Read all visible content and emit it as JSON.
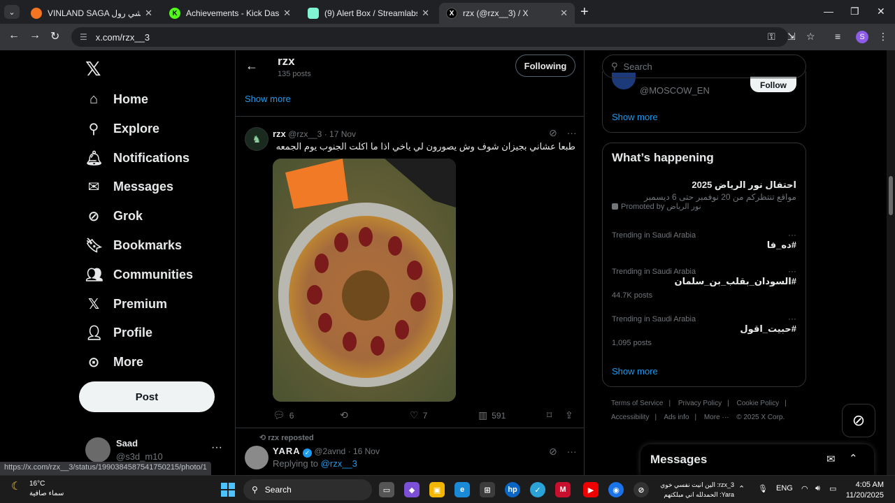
{
  "browser": {
    "tabs": [
      {
        "title": "VINLAND SAGA للي كرانشي رول",
        "color": "#f47521",
        "glyph": ""
      },
      {
        "title": "Achievements - Kick Dashboard",
        "color": "#53fc18",
        "glyph": "K"
      },
      {
        "title": "(9) Alert Box / Streamlabs",
        "color": "#80f5d2",
        "glyph": ""
      },
      {
        "title": "rzx (@rzx__3) / X",
        "color": "#000000",
        "glyph": "X"
      }
    ],
    "url": "x.com/rzx__3",
    "profile_initial": "S",
    "status_url": "https://x.com/rzx__3/status/1990384587541750215/photo/1"
  },
  "nav": {
    "items": [
      {
        "label": "Home",
        "icon": "home-icon"
      },
      {
        "label": "Explore",
        "icon": "search-icon"
      },
      {
        "label": "Notifications",
        "icon": "bell-icon"
      },
      {
        "label": "Messages",
        "icon": "mail-icon"
      },
      {
        "label": "Grok",
        "icon": "grok-icon"
      },
      {
        "label": "Bookmarks",
        "icon": "bookmark-icon"
      },
      {
        "label": "Communities",
        "icon": "people-icon"
      },
      {
        "label": "Premium",
        "icon": "x-icon"
      },
      {
        "label": "Profile",
        "icon": "person-icon"
      },
      {
        "label": "More",
        "icon": "more-circle-icon"
      }
    ],
    "post_label": "Post",
    "account": {
      "name": "Saad",
      "handle": "@s3d_m10"
    }
  },
  "profile_header": {
    "name": "rzx",
    "posts": "135 posts",
    "following_label": "Following",
    "show_more": "Show more"
  },
  "tweet": {
    "name": "rzx",
    "handle": "@rzx__3",
    "date": "17 Nov",
    "text": "طبعا عشاني بجيزان شوف وش يصورون لي ياخي اذا ما اكلت الجنوب يوم الجمعه",
    "replies": "6",
    "likes": "7",
    "views": "591"
  },
  "tweet2": {
    "repost_label": "rzx reposted",
    "name": "YARA",
    "handle": "@2avnd",
    "date": "16 Nov",
    "replying_prefix": "Replying to",
    "replying_to": "@rzx__3"
  },
  "right": {
    "search_placeholder": "Search",
    "who_to_follow_handle": "@MOSCOW_EN",
    "follow_label": "Follow",
    "show_more": "Show more",
    "happening_title": "What’s happening",
    "promoted": {
      "title": "احتفال نور الرياض 2025",
      "subtitle": "مواقع تنتظركم من 20 نوفمبر حتى 6 ديسمبر",
      "by": "Promoted by نور الرياض"
    },
    "trends": [
      {
        "context": "Trending in Saudi Arabia",
        "tag": "#ده_فا",
        "posts": ""
      },
      {
        "context": "Trending in Saudi Arabia",
        "tag": "#السودان_بقلب_بن_سلمان",
        "posts": "44.7K posts"
      },
      {
        "context": "Trending in Saudi Arabia",
        "tag": "#حبيت_اقول",
        "posts": "1,095 posts"
      }
    ],
    "happening_more": "Show more",
    "footer": [
      "Terms of Service",
      "|",
      "Privacy Policy",
      "|",
      "Cookie Policy",
      "|",
      "Accessibility",
      "|",
      "Ads info",
      "|",
      "More ···",
      "© 2025 X Corp."
    ],
    "messages_title": "Messages"
  },
  "taskbar": {
    "temp": "16°C",
    "condition": "سماء صافية",
    "search_label": "Search",
    "notif_line1": "rzx_3: الين انيت نفسي خوي",
    "notif_line2": "Yara: الحمدلله اني مبلكتهم",
    "lang": "ENG",
    "time": "4:05 AM",
    "date": "11/20/2025"
  }
}
